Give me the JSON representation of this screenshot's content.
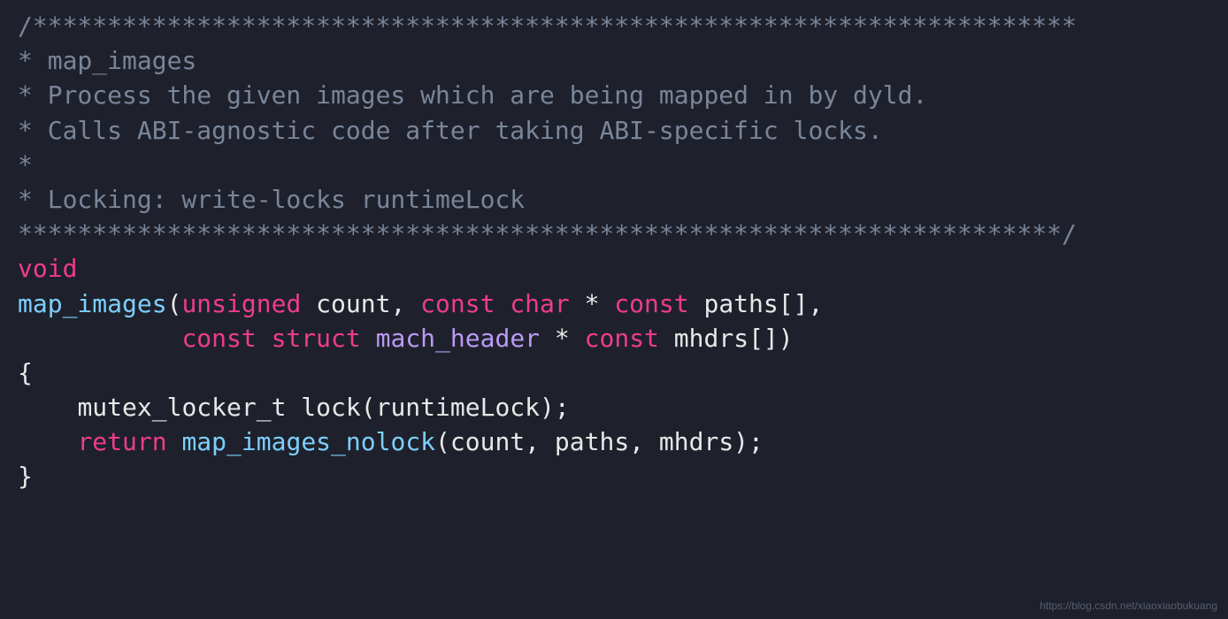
{
  "code": {
    "c1": "/**********************************************************************",
    "c2": "* map_images",
    "c3": "* Process the given images which are being mapped in by dyld.",
    "c4": "* Calls ABI-agnostic code after taking ABI-specific locks.",
    "c5": "*",
    "c6": "* Locking: write-locks runtimeLock",
    "c7": "**********************************************************************/",
    "kw_void": "void",
    "fn_name": "map_images",
    "paren_open": "(",
    "kw_unsigned": "unsigned",
    "param_count": " count, ",
    "kw_const1": "const",
    "sp1": " ",
    "kw_char": "char",
    "star_const": " * ",
    "kw_const2": "const",
    "param_paths": " paths[],",
    "indent2": "           ",
    "kw_const3": "const",
    "sp2": " ",
    "kw_struct": "struct",
    "sp3": " ",
    "type_mh": "mach_header",
    "star_const2": " * ",
    "kw_const4": "const",
    "param_mhdrs": " mhdrs[])",
    "brace_open": "{",
    "body_indent": "    ",
    "line_lock": "mutex_locker_t lock(runtimeLock);",
    "kw_return": "return",
    "sp4": " ",
    "fn_call": "map_images_nolock",
    "call_args": "(count, paths, mhdrs);",
    "brace_close": "}"
  },
  "watermark": "https://blog.csdn.net/xiaoxiaobukuang"
}
